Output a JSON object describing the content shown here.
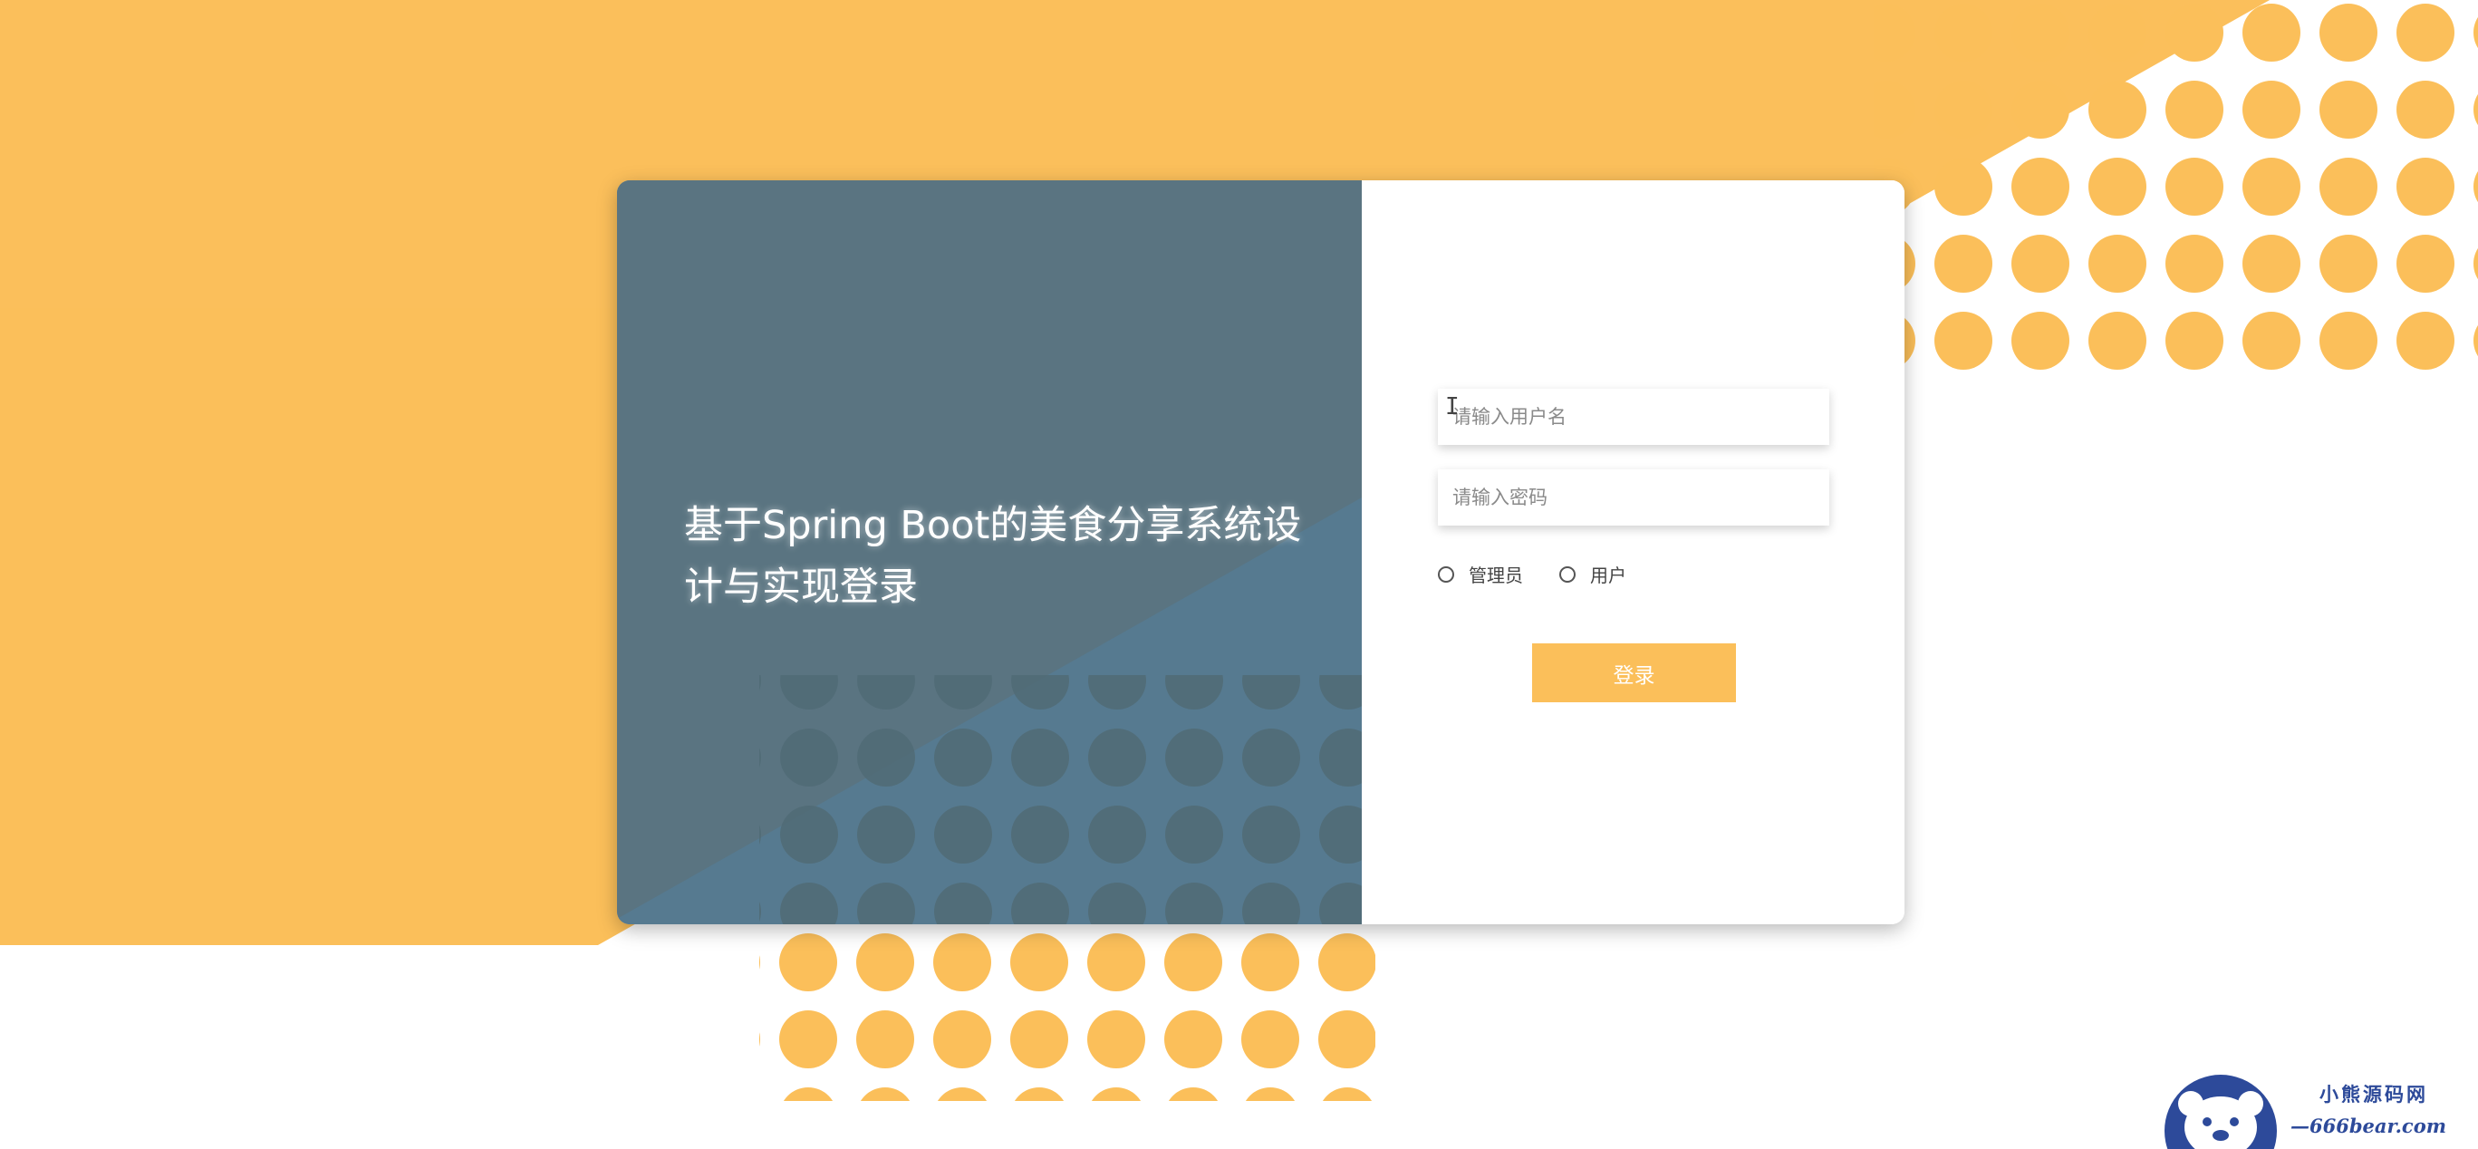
{
  "background": {
    "accent_color": "#fbbf5a",
    "panel_color": "#5a7481"
  },
  "login_panel": {
    "title": "基于Spring Boot的美食分享系统设计与实现登录"
  },
  "login_form": {
    "username_placeholder": "请输入用户名",
    "password_placeholder": "请输入密码",
    "roles": [
      {
        "label": "管理员",
        "selected": false
      },
      {
        "label": "用户",
        "selected": false
      }
    ],
    "login_button_label": "登录"
  },
  "watermark": {
    "logo_icon": "bear-icon",
    "brand": "小熊源码网",
    "site": "—666bear.com—"
  }
}
